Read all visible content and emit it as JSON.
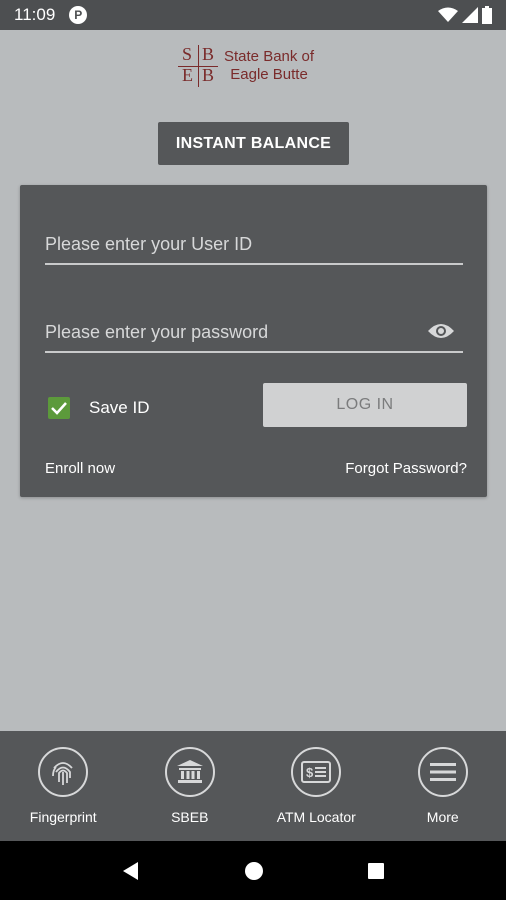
{
  "status_bar": {
    "time": "11:09",
    "app_indicator": "P"
  },
  "logo": {
    "letters": [
      "S",
      "B",
      "E",
      "B"
    ],
    "line1": "State Bank of",
    "line2": "Eagle Butte",
    "color": "#7a2b2b"
  },
  "instant_balance": {
    "label": "INSTANT BALANCE"
  },
  "login_card": {
    "user_placeholder": "Please enter your User ID",
    "password_placeholder": "Please enter your password",
    "save_id_label": "Save ID",
    "save_id_checked": true,
    "login_label": "LOG IN",
    "enroll_label": "Enroll now",
    "forgot_label": "Forgot Password?"
  },
  "bottom_nav": {
    "items": [
      {
        "label": "Fingerprint",
        "icon": "fingerprint-icon"
      },
      {
        "label": "SBEB",
        "icon": "bank-icon"
      },
      {
        "label": "ATM Locator",
        "icon": "atm-card-icon"
      },
      {
        "label": "More",
        "icon": "menu-icon"
      }
    ]
  },
  "colors": {
    "background": "#b8bbbd",
    "card": "#555759",
    "accent_check": "#5c9a3b"
  }
}
